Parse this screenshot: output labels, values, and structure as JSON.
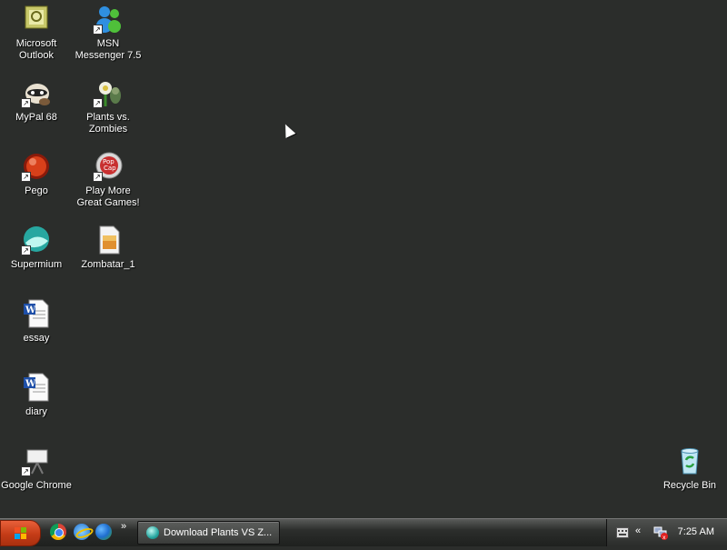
{
  "desktop": {
    "icons": [
      {
        "label": "Microsoft Outlook",
        "icon": "outlook-icon"
      },
      {
        "label": "MSN Messenger 7.5",
        "icon": "msn-messenger-icon"
      },
      {
        "label": "MyPal 68",
        "icon": "mypal-icon"
      },
      {
        "label": "Plants vs. Zombies",
        "icon": "plants-vs-zombies-icon"
      },
      {
        "label": "Pego",
        "icon": "pego-icon"
      },
      {
        "label": "Play More Great Games!",
        "icon": "popcap-icon"
      },
      {
        "label": "Supermium",
        "icon": "supermium-icon"
      },
      {
        "label": "Zombatar_1",
        "icon": "image-file-icon"
      },
      {
        "label": "essay",
        "icon": "word-document-icon"
      },
      {
        "label": "diary",
        "icon": "word-document-icon"
      },
      {
        "label": "Google Chrome",
        "icon": "chrome-shortcut-icon"
      },
      {
        "label": "Recycle Bin",
        "icon": "recycle-bin-icon"
      }
    ]
  },
  "taskbar": {
    "start_icon": "windows-logo-icon",
    "quick_launch": [
      "chrome-icon",
      "internet-explorer-icon",
      "msn-icon"
    ],
    "more_glyph": "»",
    "tasks": [
      {
        "label": "Download Plants VS Z...",
        "icon": "supermium-icon"
      }
    ],
    "tray_expand": "«",
    "clock": "7:25 AM"
  },
  "colors": {
    "desktop_bg": "#2b2d2b",
    "start_button": "#c43c17"
  }
}
